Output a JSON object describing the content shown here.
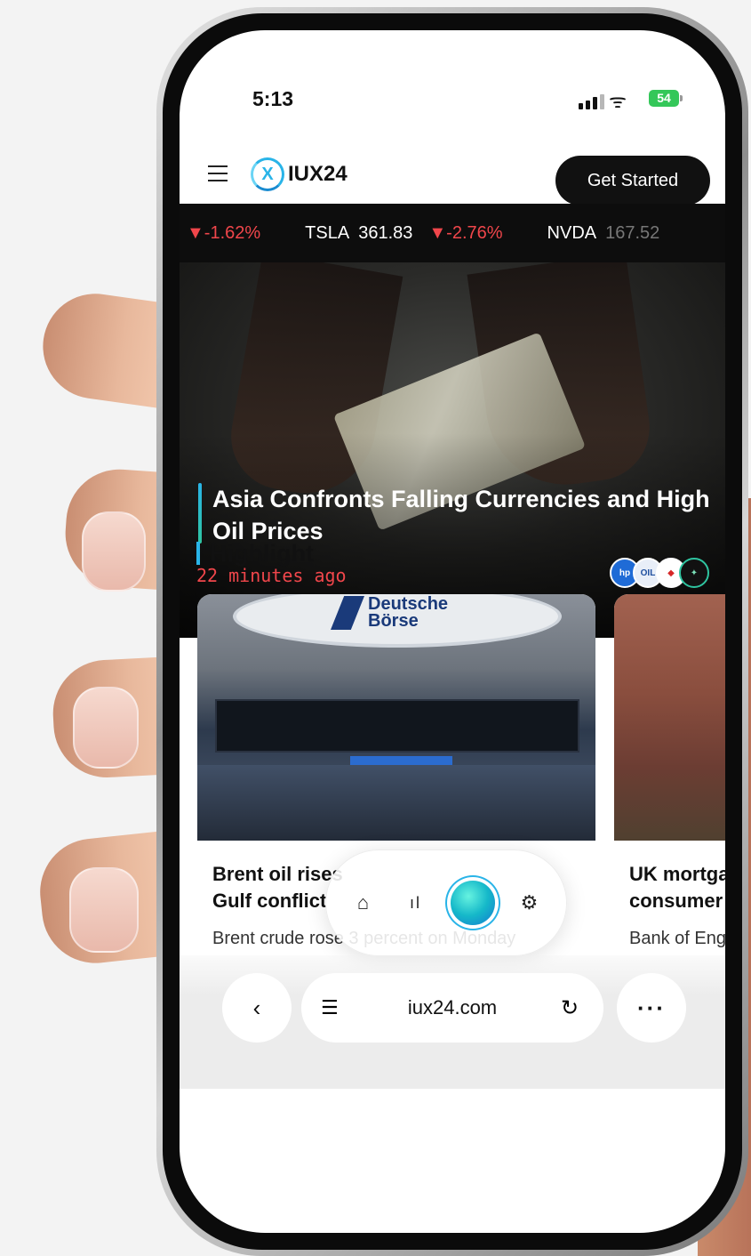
{
  "status_bar": {
    "time": "5:13",
    "battery": "54"
  },
  "header": {
    "logo_mark": "X",
    "logo_text": "IUX24",
    "cta_label": "Get Started"
  },
  "ticker": [
    {
      "symbol": "",
      "price": "",
      "change": "▼-1.62%",
      "direction": "down"
    },
    {
      "symbol": "TSLA",
      "price": "361.83",
      "change": "▼-2.76%",
      "direction": "down"
    },
    {
      "symbol": "NVDA",
      "price": "167.52",
      "change": "",
      "direction": ""
    }
  ],
  "hero": {
    "title": "Asia Confronts Falling Currencies and High Oil Prices",
    "time_ago": "22 minutes ago",
    "sources": [
      "hp",
      "OIL",
      "◆",
      "✦"
    ]
  },
  "highlight": {
    "section_title": "Highlight",
    "cards": [
      {
        "image_brand": "Deutsche Börse",
        "title_line1": "Brent oil rises",
        "title_line2": "Gulf conflict",
        "summary": "Brent crude rose 3 percent on Monday"
      },
      {
        "title_line1": "UK mortgage",
        "title_line2": "consumer",
        "summary": "Bank of England"
      }
    ]
  },
  "floating_nav": {
    "items": [
      "home-icon",
      "chart-icon",
      "assistant-orb",
      "settings-icon"
    ]
  },
  "browser": {
    "url": "iux24.com"
  },
  "colors": {
    "accent": "#29b4e8",
    "negative": "#f0464b",
    "dark": "#111111"
  }
}
